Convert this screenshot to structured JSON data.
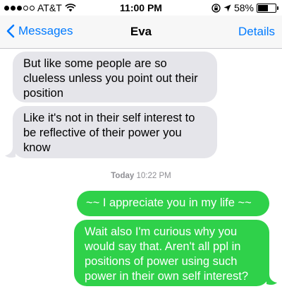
{
  "status_bar": {
    "carrier": "AT&T",
    "time": "11:00 PM",
    "battery": "58%",
    "battery_level": 0.58
  },
  "nav": {
    "back_label": "Messages",
    "title": "Eva",
    "details_label": "Details"
  },
  "messages": [
    {
      "direction": "received",
      "text": "But like some people are so clueless unless you point out their position"
    },
    {
      "direction": "received",
      "text": "Like it's not in their self interest to be reflective of their power you know"
    },
    {
      "direction": "sent",
      "text": "~~ I appreciate you in my life ~~"
    },
    {
      "direction": "sent",
      "text": "Wait also I'm curious why you would say that. Aren't all ppl in positions of power using such power in their own self interest?"
    }
  ],
  "timestamp": {
    "day": "Today",
    "time": "10:22 PM"
  }
}
